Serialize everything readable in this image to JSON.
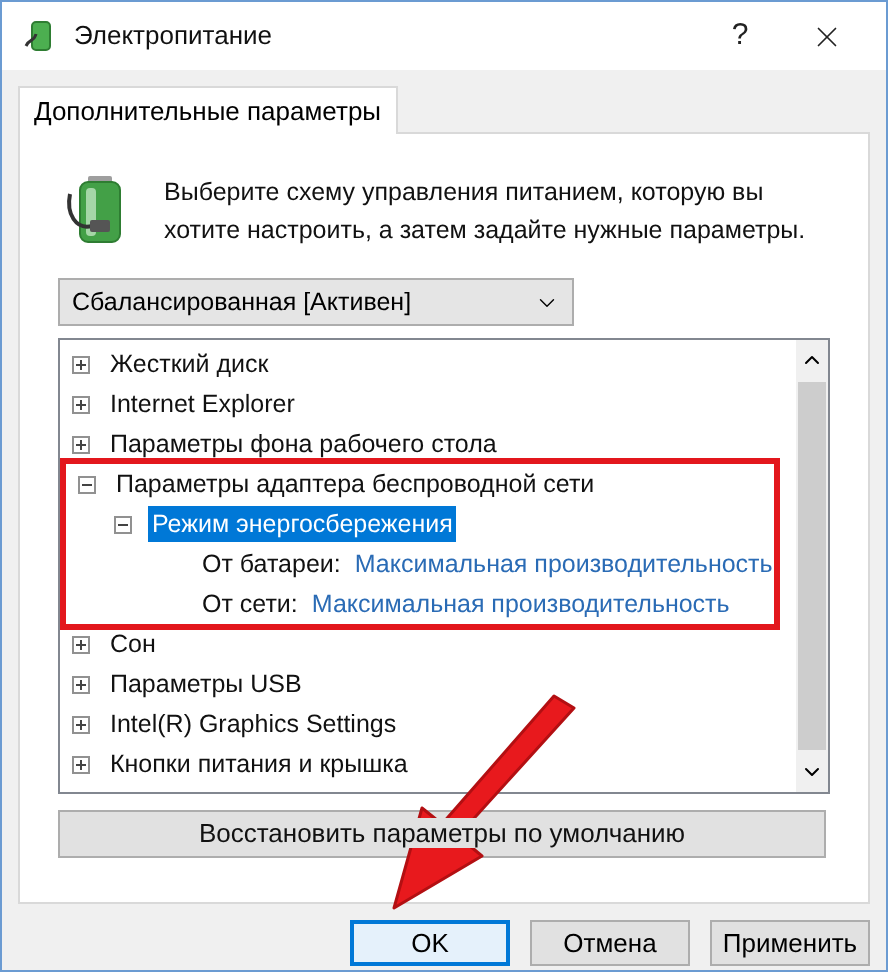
{
  "window": {
    "title": "Электропитание",
    "help": "?"
  },
  "tabs": [
    {
      "label": "Дополнительные параметры",
      "selected": true
    }
  ],
  "intro": "Выберите схему управления питанием, которую вы хотите настроить, а затем задайте нужные параметры.",
  "plan_select": {
    "value": "Сбалансированная [Активен]"
  },
  "tree": [
    {
      "kind": "group",
      "label": "Жесткий диск",
      "expanded": false,
      "selected": false,
      "highlighted": false
    },
    {
      "kind": "group",
      "label": "Internet Explorer",
      "expanded": false,
      "selected": false,
      "highlighted": false
    },
    {
      "kind": "group",
      "label": "Параметры фона рабочего стола",
      "expanded": false,
      "selected": false,
      "highlighted": false
    },
    {
      "kind": "group",
      "label": "Параметры адаптера беспроводной сети",
      "expanded": true,
      "selected": false,
      "highlighted": true,
      "children": [
        {
          "kind": "group",
          "label": "Режим энергосбережения",
          "expanded": true,
          "selected": true,
          "children": [
            {
              "kind": "setting",
              "label": "От батареи:",
              "value": "Максимальная производительность",
              "selected": false
            },
            {
              "kind": "setting",
              "label": "От сети:",
              "value": "Максимальная производительность",
              "selected": false
            }
          ]
        }
      ]
    },
    {
      "kind": "group",
      "label": "Сон",
      "expanded": false,
      "selected": false,
      "highlighted": false
    },
    {
      "kind": "group",
      "label": "Параметры USB",
      "expanded": false,
      "selected": false,
      "highlighted": false
    },
    {
      "kind": "group",
      "label": "Intel(R) Graphics Settings",
      "expanded": false,
      "selected": false,
      "highlighted": false
    },
    {
      "kind": "group",
      "label": "Кнопки питания и крышка",
      "expanded": false,
      "selected": false,
      "highlighted": false
    }
  ],
  "restore_button": "Восстановить параметры по умолчанию",
  "buttons": [
    {
      "label": "OK",
      "default": true
    },
    {
      "label": "Отмена",
      "default": false
    },
    {
      "label": "Применить",
      "default": false
    }
  ]
}
